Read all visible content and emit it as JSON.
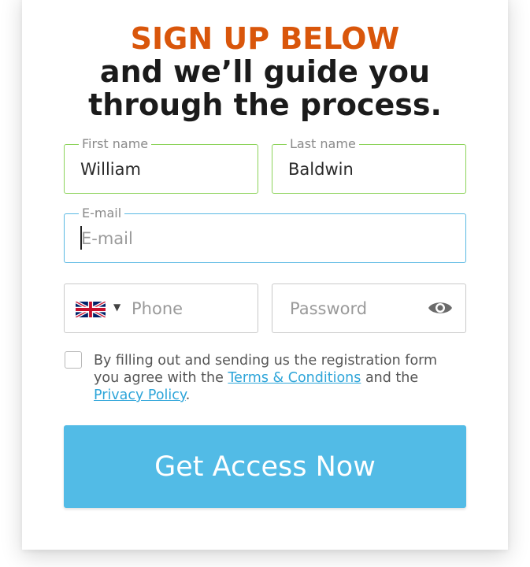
{
  "header": {
    "accent": "SIGN UP BELOW",
    "line1": "and we’ll guide you",
    "line2": "through the process."
  },
  "form": {
    "first_name": {
      "label": "First name",
      "value": "William"
    },
    "last_name": {
      "label": "Last name",
      "value": "Baldwin"
    },
    "email": {
      "label": "E-mail",
      "placeholder": "E-mail"
    },
    "phone": {
      "placeholder": "Phone",
      "flag": "uk-flag-icon"
    },
    "password": {
      "placeholder": "Password",
      "icon": "eye-icon"
    },
    "consent": {
      "text_before": "By filling out and sending us the registration form you agree with the ",
      "terms_link": "Terms & Conditions",
      "text_middle": " and the ",
      "privacy_link": "Privacy Policy",
      "text_after": "."
    },
    "submit_label": "Get Access Now"
  },
  "colors": {
    "accent": "#d9560b",
    "valid_border": "#8cd35a",
    "focus_border": "#5ab8e3",
    "button": "#52bbe6",
    "link": "#2ea5d9"
  }
}
